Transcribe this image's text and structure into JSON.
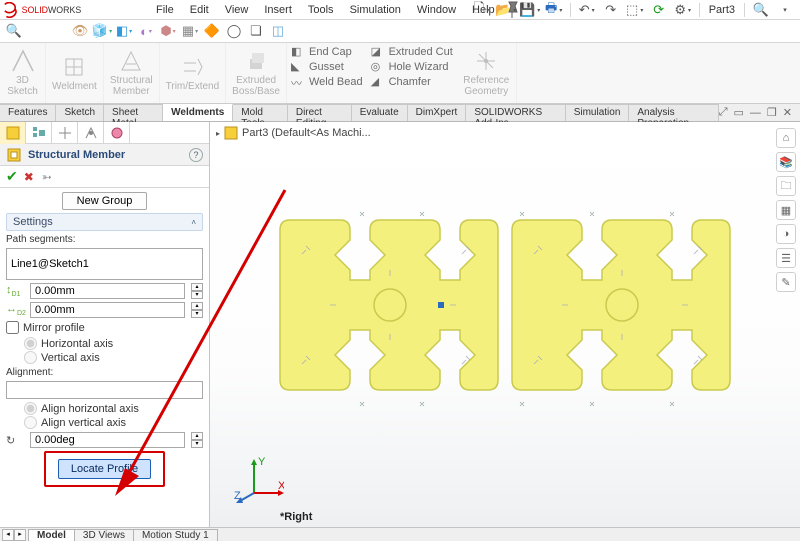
{
  "app": {
    "brand_prefix": "SOLID",
    "brand_suffix": "WORKS"
  },
  "menus": [
    "File",
    "Edit",
    "View",
    "Insert",
    "Tools",
    "Simulation",
    "Window",
    "Help"
  ],
  "quick": {
    "part_label": "Part3"
  },
  "ribbon": {
    "big": [
      {
        "name": "3d-sketch",
        "label": "3D\nSketch"
      },
      {
        "name": "weldment",
        "label": "Weldment"
      },
      {
        "name": "structural-member",
        "label": "Structural\nMember"
      },
      {
        "name": "trim-extend",
        "label": "Trim/Extend"
      },
      {
        "name": "extruded-boss",
        "label": "Extruded\nBoss/Base"
      }
    ],
    "col1": [
      "End Cap",
      "Gusset",
      "Weld Bead"
    ],
    "col2": [
      "Extruded Cut",
      "Hole Wizard",
      "Chamfer"
    ],
    "ref": "Reference\nGeometry"
  },
  "tabs": [
    "Features",
    "Sketch",
    "Sheet Metal",
    "Weldments",
    "Mold Tools",
    "Direct Editing",
    "Evaluate",
    "DimXpert",
    "SOLIDWORKS Add-Ins",
    "Simulation",
    "Analysis Preparation"
  ],
  "active_tab": 3,
  "breadcrumb": "Part3  (Default<As Machi...",
  "view_label": "*Right",
  "bottom_tabs": [
    "Model",
    "3D Views",
    "Motion Study 1"
  ],
  "active_bottom": 0,
  "pm": {
    "title": "Structural Member",
    "new_group": "New Group",
    "settings_hdr": "Settings",
    "path_lbl": "Path segments:",
    "path_val": "Line1@Sketch1",
    "dim_a": "0.00mm",
    "dim_b": "0.00mm",
    "mirror_lbl": "Mirror profile",
    "mirror_h": "Horizontal axis",
    "mirror_v": "Vertical axis",
    "align_lbl": "Alignment:",
    "align_h": "Align horizontal axis",
    "align_v": "Align vertical axis",
    "rot": "0.00deg",
    "locate": "Locate Profile"
  },
  "triad": {
    "x": "X",
    "y": "Y",
    "z": "Z"
  }
}
